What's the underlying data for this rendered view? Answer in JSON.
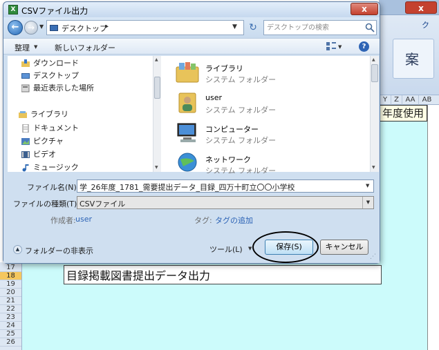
{
  "dialog": {
    "title": "CSVファイル出力",
    "app_icon_glyph": "X",
    "close_glyph": "x"
  },
  "nav": {
    "back_glyph": "←",
    "forward_glyph": "→",
    "address": "デスクトップ",
    "address_separator": "▸",
    "search_placeholder": "デスクトップの検索"
  },
  "toolbar": {
    "organize": "整理",
    "new_folder": "新しいフォルダー",
    "help": "?"
  },
  "navigation_pane": {
    "items": [
      {
        "label": "ダウンロード",
        "icon": "download-folder-icon"
      },
      {
        "label": "デスクトップ",
        "icon": "desktop-icon",
        "selected": true
      },
      {
        "label": "最近表示した場所",
        "icon": "recent-places-icon"
      },
      {
        "label": "ライブラリ",
        "icon": "libraries-icon",
        "group": true
      },
      {
        "label": "ドキュメント",
        "icon": "documents-icon"
      },
      {
        "label": "ピクチャ",
        "icon": "pictures-icon"
      },
      {
        "label": "ビデオ",
        "icon": "videos-icon"
      },
      {
        "label": "ミュージック",
        "icon": "music-icon"
      }
    ]
  },
  "file_list": {
    "items": [
      {
        "name": "ライブラリ",
        "type": "システム フォルダー",
        "icon": "library-folder-icon"
      },
      {
        "name": "user",
        "type": "システム フォルダー",
        "icon": "user-folder-icon"
      },
      {
        "name": "コンピューター",
        "type": "システム フォルダー",
        "icon": "computer-icon"
      },
      {
        "name": "ネットワーク",
        "type": "システム フォルダー",
        "icon": "network-icon"
      }
    ]
  },
  "form": {
    "filename_label": "ファイル名(N):",
    "filename_value": "学_26年度_1781_需要提出データ_目録_四万十町立〇〇小学校",
    "filetype_label": "ファイルの種類(T):",
    "filetype_value": "CSVファイル",
    "author_label": "作成者:",
    "author_value": "user",
    "tag_label": "タグ:",
    "tag_value": "タグの追加"
  },
  "footer": {
    "hide_folders": "フォルダーの非表示",
    "tools": "ツール(L)",
    "save": "保存(S)",
    "cancel": "キャンセル"
  },
  "background": {
    "ribbon_tab": "ク",
    "ribbon_glyph": "案",
    "columns": [
      "Y",
      "Z",
      "AA",
      "AB"
    ],
    "year_text": "年度使用",
    "label_text": "目録掲載図書提出データ出力",
    "rows": [
      "17",
      "18",
      "19",
      "20",
      "21",
      "22",
      "23",
      "24",
      "25",
      "26"
    ],
    "active_row": "18"
  }
}
